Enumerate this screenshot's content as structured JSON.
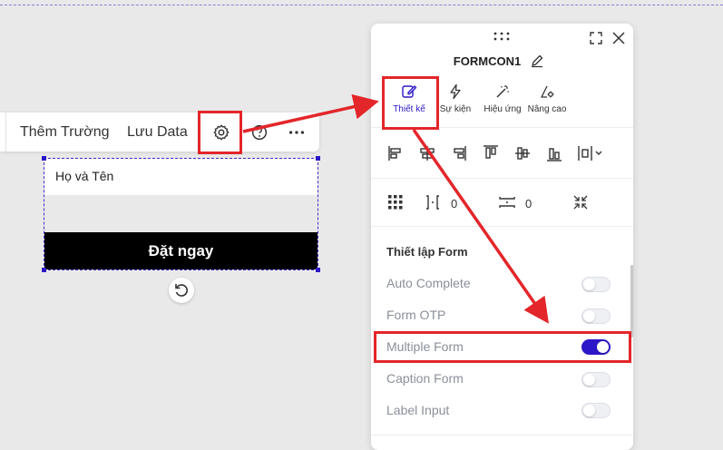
{
  "toolbar": {
    "add_field": "Thêm Trường",
    "save_data": "Lưu Data"
  },
  "form": {
    "name_field_placeholder": "Họ và Tên",
    "submit_label": "Đặt ngay"
  },
  "panel": {
    "title": "FORMCON1",
    "tabs": [
      {
        "label": "Thiết kế",
        "icon": "pencil-edit-icon",
        "active": true
      },
      {
        "label": "Sự kiện",
        "icon": "lightning-icon",
        "active": false
      },
      {
        "label": "Hiệu ứng",
        "icon": "magic-wand-icon",
        "active": false
      },
      {
        "label": "Nâng cao",
        "icon": "settings-advanced-icon",
        "active": false
      }
    ],
    "spacing": {
      "horizontal": "0",
      "vertical": "0"
    },
    "section_title": "Thiết lập Form",
    "settings": [
      {
        "label": "Auto Complete",
        "on": false
      },
      {
        "label": "Form OTP",
        "on": false
      },
      {
        "label": "Multiple Form",
        "on": true
      },
      {
        "label": "Caption Form",
        "on": false
      },
      {
        "label": "Label Input",
        "on": false
      }
    ]
  },
  "colors": {
    "accent": "#2b17c7",
    "annotation": "#e3262a",
    "button_bg": "#000000"
  }
}
